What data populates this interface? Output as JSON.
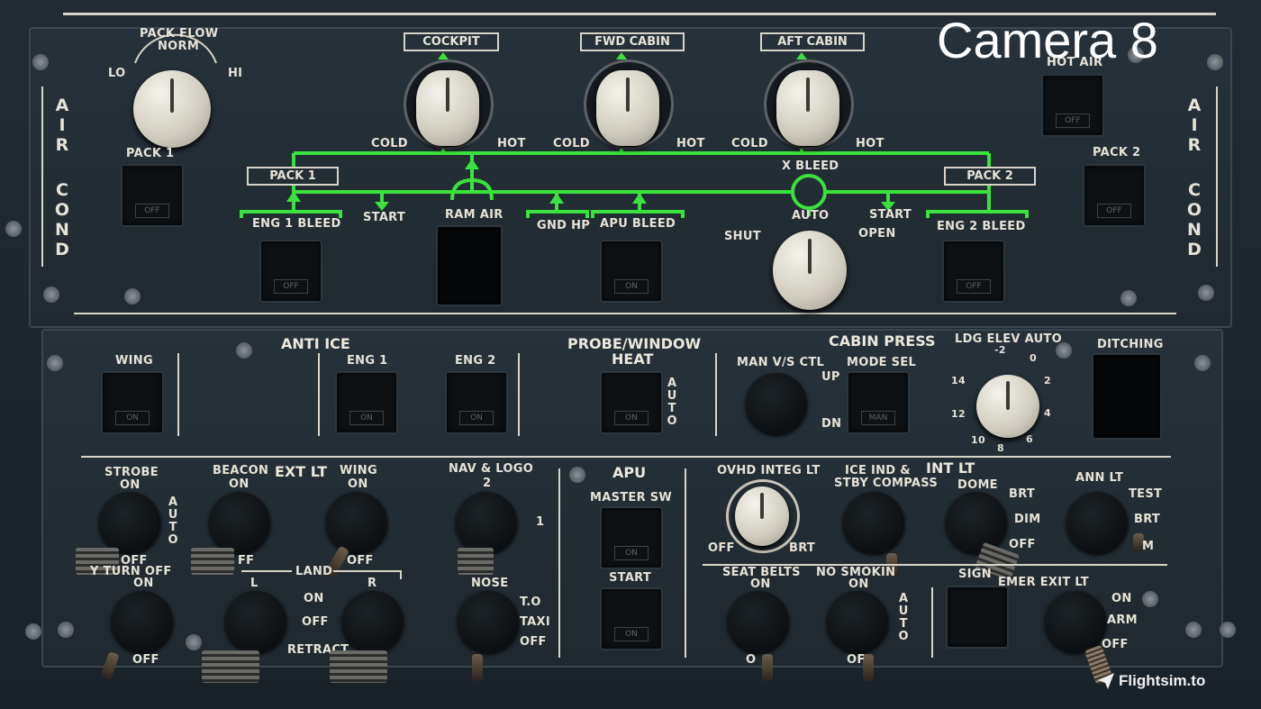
{
  "overlay": {
    "camera": "Camera 8",
    "watermark": "Flightsim.to"
  },
  "air_cond": {
    "side_title": [
      "A",
      "I",
      "R",
      "C",
      "O",
      "N",
      "D"
    ],
    "pack_flow": {
      "title1": "PACK FLOW",
      "title2": "NORM",
      "lo": "LO",
      "hi": "HI"
    },
    "pack1_label": "PACK 1",
    "pack1_pb": "OFF",
    "pack2_label": "PACK 2",
    "pack2_pb": "OFF",
    "hot_air_label": "HOT AIR",
    "hot_air_pb": "OFF",
    "zones": [
      {
        "name": "COCKPIT",
        "cold": "COLD",
        "hot": "HOT"
      },
      {
        "name": "FWD CABIN",
        "cold": "COLD",
        "hot": "HOT"
      },
      {
        "name": "AFT CABIN",
        "cold": "COLD",
        "hot": "HOT"
      }
    ],
    "pack1_box": "PACK 1",
    "pack2_box": "PACK 2",
    "x_bleed": "X BLEED",
    "start_left": "START",
    "start_right": "START",
    "ram_air": "RAM AIR",
    "gnd_hp": "GND HP",
    "apu_bleed": "APU BLEED",
    "apu_bleed_pb": "ON",
    "eng1_bleed": "ENG 1 BLEED",
    "eng1_bleed_pb": "OFF",
    "eng2_bleed": "ENG 2 BLEED",
    "eng2_bleed_pb": "OFF",
    "xbleed_auto": "AUTO",
    "xbleed_shut": "SHUT",
    "xbleed_open": "OPEN"
  },
  "anti_ice": {
    "title": "ANTI ICE",
    "wing": "WING",
    "wing_pb": "ON",
    "eng1": "ENG 1",
    "eng1_pb": "ON",
    "eng2": "ENG 2",
    "eng2_pb": "ON"
  },
  "probe": {
    "title1": "PROBE/WINDOW",
    "title2": "HEAT",
    "pb": "ON",
    "auto": [
      "A",
      "U",
      "T",
      "O"
    ]
  },
  "cabin_press": {
    "title": "CABIN PRESS",
    "man_vs": "MAN V/S CTL",
    "up": "UP",
    "dn": "DN",
    "mode_sel": "MODE SEL",
    "mode_pb": "MAN",
    "ldg_elev": "LDG ELEV AUTO",
    "scale": [
      "-2",
      "0",
      "2",
      "4",
      "6",
      "8",
      "10",
      "12",
      "14"
    ],
    "ditching": "DITCHING"
  },
  "ext_lt": {
    "title": "EXT LT",
    "strobe": "STROBE",
    "strobe_on": "ON",
    "strobe_auto": [
      "A",
      "U",
      "T",
      "O"
    ],
    "strobe_off": "OFF",
    "beacon": "BEACON",
    "beacon_on": "ON",
    "beacon_off": "FF",
    "wing": "WING",
    "wing_on": "ON",
    "wing_off": "OFF",
    "nav_logo": "NAV & LOGO",
    "nav_2": "2",
    "nav_1": "1",
    "rwy_turn_off": "Y TURN OFF",
    "rwy_on": "ON",
    "rwy_off": "OFF",
    "land": "LAND",
    "land_l": "L",
    "land_r": "R",
    "land_on": "ON",
    "land_off": "OFF",
    "land_retract": "RETRACT",
    "nose": "NOSE",
    "nose_to": "T.O",
    "nose_taxi": "TAXI",
    "nose_off": "OFF"
  },
  "apu": {
    "title": "APU",
    "master": "MASTER SW",
    "master_pb": "ON",
    "start": "START",
    "start_pb": "ON"
  },
  "int_lt": {
    "title": "INT LT",
    "ovhd": "OVHD INTEG LT",
    "ovhd_off": "OFF",
    "ovhd_brt": "BRT",
    "ice_ind1": "ICE IND &",
    "ice_ind2": "STBY COMPASS",
    "dome": "DOME",
    "dome_brt": "BRT",
    "dome_dim": "DIM",
    "dome_off": "OFF",
    "ann": "ANN LT",
    "ann_test": "TEST",
    "ann_brt": "BRT",
    "ann_dm": "M"
  },
  "signs": {
    "seat_belts": "SEAT BELTS",
    "sb_on": "ON",
    "sb_off": "O",
    "no_smoking": "NO SMOKIN",
    "ns_on": "ON",
    "ns_off": "OF",
    "ns_auto": [
      "A",
      "U",
      "T",
      "O"
    ],
    "signs_label": "SIGN",
    "emer_exit": "EMER EXIT LT",
    "ee_on": "ON",
    "ee_arm": "ARM",
    "ee_off": "OFF"
  },
  "colors": {
    "green_line": "#39e23c",
    "panel": "#222b33",
    "label": "#e6e2d6"
  }
}
